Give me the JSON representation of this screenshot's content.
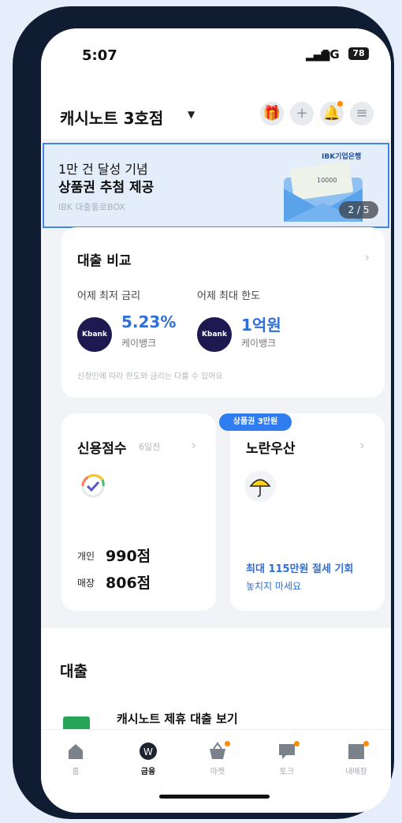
{
  "status": {
    "time": "5:07",
    "network": "5G",
    "battery": "78"
  },
  "header": {
    "store_name": "캐시노트 3호점"
  },
  "banner": {
    "title": "1만 건 달성 기념",
    "subtitle": "상품권 추첨 제공",
    "desc": "IBK 대출통로BOX",
    "bank_tag": "IBK기업은행",
    "voucher_value": "10000",
    "pager": "2 / 5"
  },
  "loan_compare": {
    "title": "대출 비교",
    "left": {
      "label": "어제 최저 금리",
      "value": "5.23%",
      "bank": "케이뱅크",
      "logo": "Kbank"
    },
    "right": {
      "label": "어제 최대 한도",
      "value": "1억원",
      "bank": "케이뱅크",
      "logo": "Kbank"
    },
    "note": "신청인에 따라 한도와 금리는 다를 수 있어요"
  },
  "credit": {
    "title": "신용점수",
    "updated": "6일전",
    "personal_label": "개인",
    "personal_score": "990점",
    "store_label": "매장",
    "store_score": "806점"
  },
  "umbrella": {
    "badge": "상품권 3만원",
    "title": "노란우산",
    "line1": "최대 115만원 절세 기회",
    "line2": "놓치지 마세요"
  },
  "loans": {
    "section_title": "대출",
    "item": "캐시노트 제휴 대출 보기"
  },
  "tabs": [
    {
      "label": "홈",
      "icon": "home-icon"
    },
    {
      "label": "금융",
      "icon": "won-icon"
    },
    {
      "label": "마켓",
      "icon": "basket-icon"
    },
    {
      "label": "토크",
      "icon": "chat-icon"
    },
    {
      "label": "내매장",
      "icon": "store-icon"
    }
  ],
  "colors": {
    "accent": "#2f6fd6",
    "badge": "#2f7df0",
    "notify": "#ff8a00",
    "kbank": "#1e1951"
  }
}
